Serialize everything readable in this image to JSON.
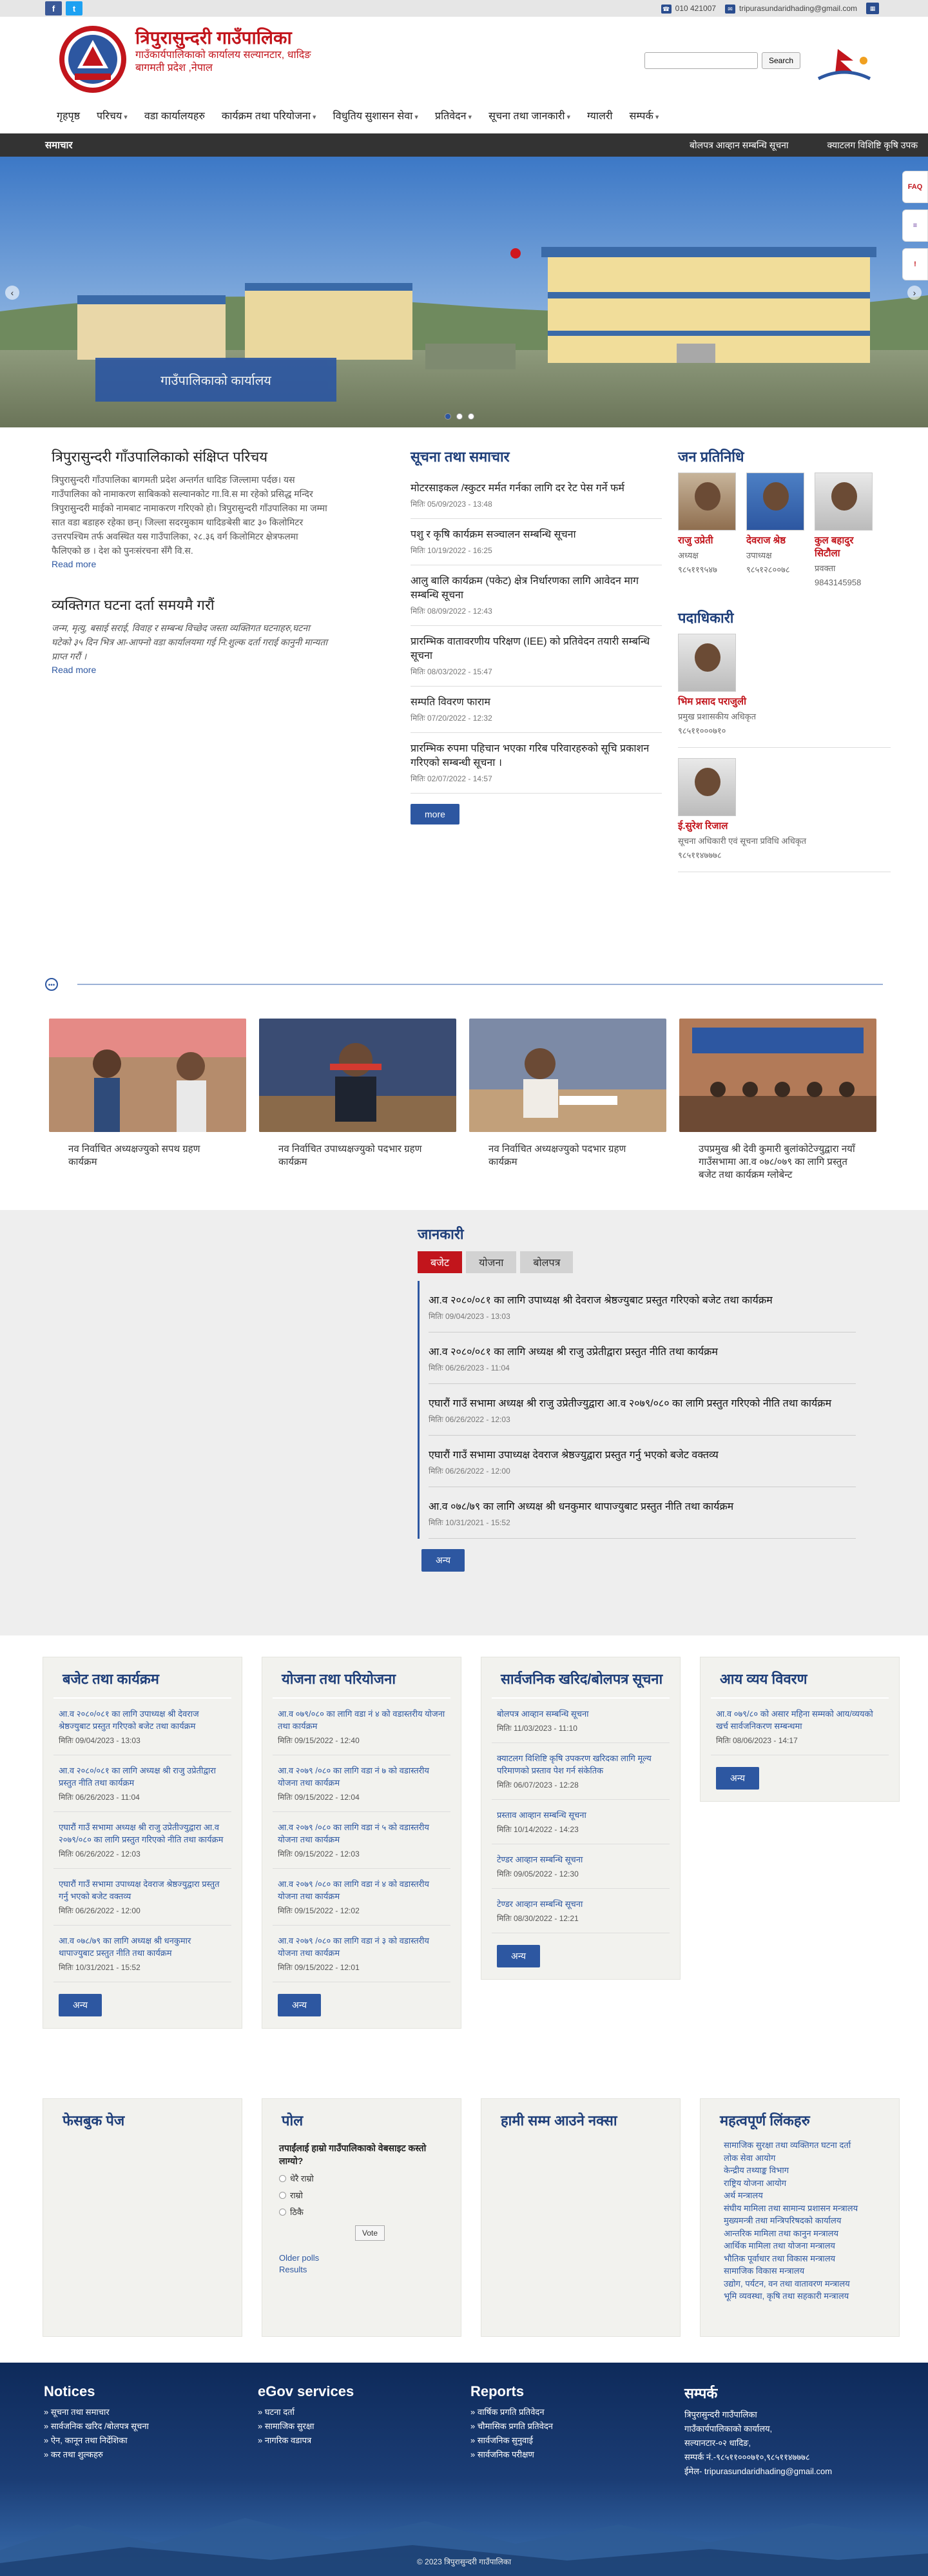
{
  "topbar": {
    "facebook": "f",
    "twitter": "t",
    "phone": "010 421007",
    "email": "tripurasundaridhading@gmail.com"
  },
  "header": {
    "title": "त्रिपुरासुन्दरी गाउँपालिका",
    "subtitle1": "गाउँकार्यपालिकाको कार्यालय सल्यानटार, धादिङ",
    "subtitle2": "बागमती प्रदेश ,नेपाल",
    "search_button": "Search"
  },
  "nav": [
    "गृहपृष्ठ",
    "परिचय",
    "वडा कार्यालयहरु",
    "कार्यक्रम तथा परियोजना",
    "विधुतिय सुशासन सेवा",
    "प्रतिवेदन",
    "सूचना तथा जानकारी",
    "ग्यालरी",
    "सम्पर्क"
  ],
  "ticker": {
    "label": "समाचार",
    "items": [
      "बोलपत्र आव्हान सम्बन्धि सूचना",
      "क्याटलग विशिष्टि कृषि उपक"
    ]
  },
  "slider": {
    "caption": "गाउँपालिकाको कार्यालय",
    "side_buttons": [
      "FAQ",
      "≡",
      "!"
    ]
  },
  "intro": {
    "title": "त्रिपुरासुन्दरी गाँउपालिकाको संक्षिप्त परिचय",
    "text": "त्रिपुरासुन्दरी गाँउपालिका बागमती प्रदेश अन्तर्गत धादिङ जिल्लामा पर्दछ। यस गाउँपालिका को नामाकरण साबिकको सल्यानकोट गा.वि.स मा रहेको प्रसिद्ध मन्दिर त्रिपुरासुन्दरी माईको नामबाट नामाकरण गरिएको हो। त्रिपुरासुन्दरी गाँउपालिका मा जम्मा सात वडा बडाहरु रहेका छन्। जिल्ला सदरमुकाम धादिङबेसी बाट ३० किलोमिटर उत्तरपश्चिम तर्फ अवस्थित यस गाउँपालिका, २८.३६ वर्ग किलोमिटर क्षेत्रफलमा फैलिएको छ । देश को पुनःसंरचना सँगै वि.स.",
    "read_more": "Read more"
  },
  "vital": {
    "title": "व्यक्तिगत घटना दर्ता समयमै गरौं",
    "text": "जन्म, मृत्यु, बसाई सराई, विवाह र सम्बन्ध विच्छेद जस्ता व्यक्तिगत घटनाहरु,घटना घटेको ३५ दिन भित्र आ-आफ्नो वडा कार्यालयमा गई नि:शुल्क दर्ता गराई कानुनी मान्यता प्राप्त गरौं ।",
    "read_more": "Read more"
  },
  "notices": {
    "title": "सूचना तथा समाचार",
    "items": [
      {
        "t": "मोटरसाइकल /स्कुटर मर्मत गर्नका लागि दर रेट पेस गर्ने फर्म",
        "d": "मितिः 05/09/2023 - 13:48"
      },
      {
        "t": "पशु र कृषि कार्यक्रम सञ्चालन सम्बन्धि सूचना",
        "d": "मितिः 10/19/2022 - 16:25"
      },
      {
        "t": "आलु बालि कार्यक्रम (पकेट) क्षेत्र निर्धारणका लागि आवेदन माग सम्बन्धि सूचना",
        "d": "मितिः 08/09/2022 - 12:43"
      },
      {
        "t": "प्रारम्भिक वातावरणीय परिक्षण (IEE) को प्रतिवेदन तयारी सम्बन्धि सूचना",
        "d": "मितिः 08/03/2022 - 15:47"
      },
      {
        "t": "सम्पति विवरण फाराम",
        "d": "मितिः 07/20/2022 - 12:32"
      },
      {
        "t": "प्रारम्भिक रुपमा पहिचान भएका गरिब परिवारहरुको सूचि प्रकाशन गरिएको सम्बन्धी सूचना ।",
        "d": "मितिः 02/07/2022 - 14:57"
      }
    ],
    "more": "more"
  },
  "reps": {
    "title": "जन प्रतिनिधि",
    "people": [
      {
        "name": "राजु उप्रेती",
        "role": "अध्यक्ष",
        "phone": "९८५११९५४७"
      },
      {
        "name": "देवराज श्रेष्ठ",
        "role": "उपाध्यक्ष",
        "phone": "९८५१२८००७८"
      },
      {
        "name": "कुल बहादुर सिटौला",
        "role": "प्रवक्ता",
        "phone": "9843145958"
      }
    ]
  },
  "officials": {
    "title": "पदाधिकारी",
    "people": [
      {
        "name": "भिम प्रसाद पराजुली",
        "role": "प्रमुख प्रशासकीय अधिकृत",
        "phone": "९८५११०००७१०"
      },
      {
        "name": "ई.सुरेश रिजाल",
        "role": "सूचना अधिकारी एवं सूचना प्रविधि अधिकृत",
        "phone": "९८५११४७७७८"
      }
    ]
  },
  "gallery": [
    "नव निर्वाचित अध्यक्षज्युको सपथ ग्रहण कार्यक्रम",
    "नव निर्वाचित उपाध्यक्षज्युको पदभार ग्रहण कार्यक्रम",
    "नव निर्वाचित अध्यक्षज्युको पदभार ग्रहण कार्यक्रम",
    "उपप्रमुख श्री देवी कुमारी बुलांकोटेज्युद्वारा नयाँ गाउँसभामा आ.व ०७८/०७९ का लागि प्रस्तुत बजेट तथा कार्यक्रम ग्लोबेन्ट"
  ],
  "info": {
    "title": "जानकारी",
    "tabs": [
      "बजेट",
      "योजना",
      "बोलपत्र"
    ],
    "items": [
      {
        "t": "आ.व २०८०/०८१ का लागि उपाध्यक्ष श्री देवराज श्रेष्ठज्युबाट प्रस्तुत गरिएको बजेट तथा कार्यक्रम",
        "d": "मितिः 09/04/2023 - 13:03"
      },
      {
        "t": "आ.व २०८०/०८१ का लागि अध्यक्ष श्री राजु उप्रेतीद्वारा प्रस्तुत नीति तथा कार्यक्रम",
        "d": "मितिः 06/26/2023 - 11:04"
      },
      {
        "t": "एघारौं गाउँ सभामा अध्यक्ष श्री राजु उप्रेतीज्युद्वारा आ.व २०७९/०८० का लागि प्रस्तुत गरिएको नीति तथा कार्यक्रम",
        "d": "मितिः 06/26/2022 - 12:03"
      },
      {
        "t": "एघारौं गाउँ सभामा उपाध्यक्ष देवराज श्रेष्ठज्युद्वारा प्रस्तुत गर्नु भएको बजेट वक्तव्य",
        "d": "मितिः 06/26/2022 - 12:00"
      },
      {
        "t": "आ.व ०७८/७९ का लागि अध्यक्ष श्री धनकुमार थापाज्युबाट प्रस्तुत नीति तथा कार्यक्रम",
        "d": "मितिः 10/31/2021 - 15:52"
      }
    ],
    "more": "अन्य"
  },
  "budget_box": {
    "title": "बजेट तथा कार्यक्रम",
    "items": [
      {
        "t": "आ.व २०८०/०८१ का लागि उपाध्यक्ष श्री देवराज श्रेष्ठज्युबाट प्रस्तुत गरिएको बजेट तथा कार्यक्रम",
        "d": "मितिः 09/04/2023 - 13:03"
      },
      {
        "t": "आ.व २०८०/०८१ का लागि अध्यक्ष श्री राजु उप्रेतीद्वारा प्रस्तुत नीति तथा कार्यक्रम",
        "d": "मितिः 06/26/2023 - 11:04"
      },
      {
        "t": "एघारौं गाउँ सभामा अध्यक्ष श्री राजु उप्रेतीज्युद्वारा आ.व २०७९/०८० का लागि प्रस्तुत गरिएको नीति तथा कार्यक्रम",
        "d": "मितिः 06/26/2022 - 12:03"
      },
      {
        "t": "एघारौं गाउँ सभामा उपाध्यक्ष देवराज श्रेष्ठज्युद्वारा प्रस्तुत गर्नु भएको बजेट वक्तव्य",
        "d": "मितिः 06/26/2022 - 12:00"
      },
      {
        "t": "आ.व ०७८/७९ का लागि अध्यक्ष श्री धनकुमार थापाज्युबाट प्रस्तुत नीति तथा कार्यक्रम",
        "d": "मितिः 10/31/2021 - 15:52"
      }
    ],
    "more": "अन्य"
  },
  "project_box": {
    "title": "योजना तथा परियोजना",
    "items": [
      {
        "t": "आ.व ०७९/०८० का लागि वडा नं ४ को वडास्तरीय योजना तथा कार्यक्रम",
        "d": "मितिः 09/15/2022 - 12:40"
      },
      {
        "t": "आ.व २०७९ /०८० का लागि वडा नं ७ को वडास्तरीय योजना तथा कार्यक्रम",
        "d": "मितिः 09/15/2022 - 12:04"
      },
      {
        "t": "आ.व २०७९ /०८० का लागि वडा नं ५ को वडास्तरीय योजना तथा कार्यक्रम",
        "d": "मितिः 09/15/2022 - 12:03"
      },
      {
        "t": "आ.व २०७९ /०८० का लागि वडा नं ४ को वडास्तरीय योजना तथा कार्यक्रम",
        "d": "मितिः 09/15/2022 - 12:02"
      },
      {
        "t": "आ.व २०७९ /०८० का लागि वडा नं ३ को वडास्तरीय योजना तथा कार्यक्रम",
        "d": "मितिः 09/15/2022 - 12:01"
      }
    ],
    "more": "अन्य"
  },
  "tender_box": {
    "title": "सार्वजनिक खरिद/बोलपत्र सूचना",
    "items": [
      {
        "t": "बोलपत्र आव्हान सम्बन्धि सूचना",
        "d": "मितिः 11/03/2023 - 11:10"
      },
      {
        "t": "क्याटलग विशिष्टि कृषि उपकरण खरिदका लागि मूल्य परिमाणको प्रस्ताव पेश गर्न संकेतिक",
        "d": "मितिः 06/07/2023 - 12:28"
      },
      {
        "t": "प्रस्ताव आव्हान सम्बन्धि सूचना",
        "d": "मितिः 10/14/2022 - 14:23"
      },
      {
        "t": "टेण्डर आव्हान सम्बन्धि सूचना",
        "d": "मितिः 09/05/2022 - 12:30"
      },
      {
        "t": "टेण्डर आव्हान सम्बन्धि सूचना",
        "d": "मितिः 08/30/2022 - 12:21"
      }
    ],
    "more": "अन्य"
  },
  "income_box": {
    "title": "आय व्यय विवरण",
    "items": [
      {
        "t": "आ.व ०७९/८० को असार महिना सम्मको आय/व्ययको खर्च सार्वजनिकरण सम्बन्धमा",
        "d": "मितिः 08/06/2023 - 14:17"
      }
    ],
    "more": "अन्य"
  },
  "fb_box": {
    "title": "फेसबुक पेज"
  },
  "poll": {
    "title": "पोल",
    "question": "तपाईंलाई हाम्रो गाउँपालिकाको वेबसाइट कस्तो लाग्यो?",
    "options": [
      "धेरै राम्रो",
      "राम्रो",
      "ठिकै"
    ],
    "vote": "Vote",
    "older": "Older polls",
    "results": "Results"
  },
  "map_box": {
    "title": "हामी सम्म आउने नक्सा"
  },
  "links_box": {
    "title": "महत्वपूर्ण लिंकहरु",
    "items": [
      "सामाजिक सुरक्षा तथा व्यक्तिगत घटना दर्ता",
      "लोक सेवा आयोग",
      "केन्द्रीय तथ्याङ्क विभाग",
      "राष्ट्रिय योजना आयोग",
      "अर्थ मन्त्रालय",
      "संघीय मामिला तथा सामान्य प्रशासन मन्त्रालय",
      "मुख्यमन्त्री तथा मन्त्रिपरिषदको कार्यालय",
      "आन्तरिक मामिला तथा कानुन मन्त्रालय",
      "आर्थिक मामिला तथा योजना मन्त्रालय",
      "भौतिक पूर्वाधार तथा विकास मन्त्रालय",
      "सामाजिक विकास मन्त्रालय",
      "उद्योग, पर्यटन, वन तथा वातावरण मन्त्रालय",
      "भूमि व्यवस्था, कृषि तथा सहकारी मन्त्रालय"
    ]
  },
  "footer": {
    "notices": {
      "title": "Notices",
      "items": [
        "सूचना तथा समाचार",
        "सार्वजनिक खरिद /बोलपत्र सूचना",
        "ऐन, कानून तथा निर्देशिका",
        "कर तथा शुल्कहरु"
      ]
    },
    "egov": {
      "title": "eGov services",
      "items": [
        "घटना दर्ता",
        "सामाजिक सुरक्षा",
        "नागरिक वडापत्र"
      ]
    },
    "reports": {
      "title": "Reports",
      "items": [
        "वार्षिक प्रगति प्रतिवेदन",
        "चौमासिक प्रगति प्रतिवेदन",
        "सार्वजनिक सुनुवाई",
        "सार्वजनिक परीक्षण"
      ]
    },
    "contact": {
      "title": "सम्पर्क",
      "lines": [
        "त्रिपुरासुन्दरी गाउँपालिका",
        "गाउँकार्यपालिकाको कार्यालय,",
        "सल्यानटार-०२ धादिङ,",
        "सम्पर्क नं.-९८५११०००७१०,९८५११४७७७८",
        "ईमेल- tripurasundaridhading@gmail.com"
      ]
    },
    "copyright": "© 2023 त्रिपुरासुन्दरी गाउँपालिका"
  }
}
